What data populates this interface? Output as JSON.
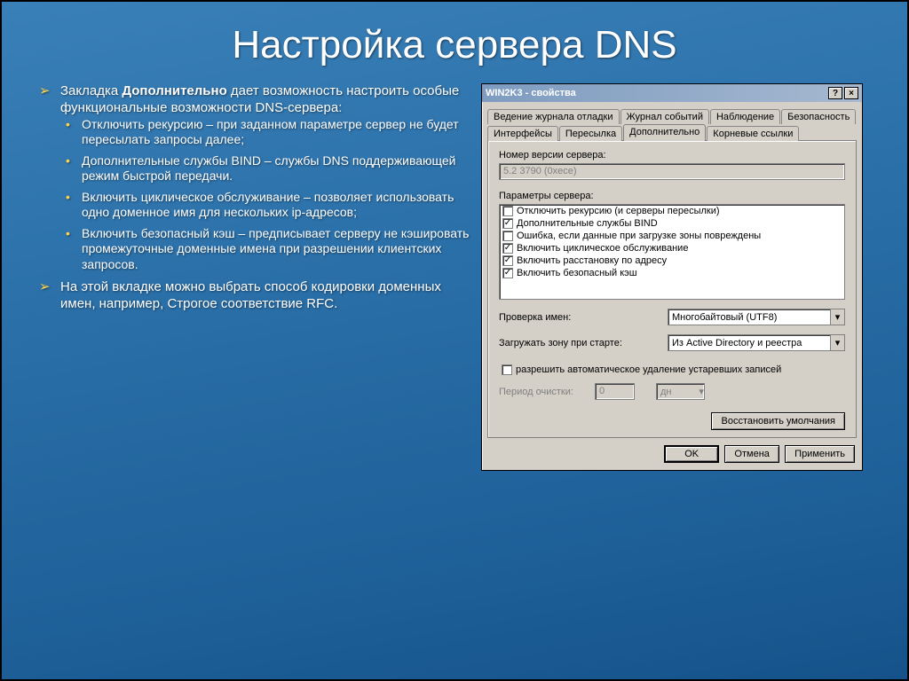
{
  "slide": {
    "title": "Настройка сервера DNS",
    "bullets": {
      "b1_prefix": "Закладка ",
      "b1_bold": "Дополнительно",
      "b1_suffix": " дает возможность настроить особые функциональные возможности DNS-сервера:",
      "sub1": "Отключить рекурсию – при заданном параметре сервер не будет пересылать запросы далее;",
      "sub2": "Дополнительные службы BIND – службы DNS поддерживающей режим быстрой передачи.",
      "sub3": "Включить циклическое обслуживание – позволяет использовать одно доменное имя для нескольких ip-адресов;",
      "sub4": "Включить безопасный кэш – предписывает серверу не кэшировать промежуточные доменные имена при разрешении клиентских запросов.",
      "b2": "На этой вкладке можно выбрать способ кодировки доменных имен, например, Строгое соответствие RFC."
    }
  },
  "dialog": {
    "title": "WIN2K3 - свойства",
    "help_icon": "?",
    "close_icon": "×",
    "tabs_row1": [
      "Ведение журнала отладки",
      "Журнал событий",
      "Наблюдение",
      "Безопасность"
    ],
    "tabs_row2": [
      "Интерфейсы",
      "Пересылка",
      "Дополнительно",
      "Корневые ссылки"
    ],
    "active_tab": "Дополнительно",
    "version_label": "Номер версии сервера:",
    "version_value": "5.2 3790 (0xece)",
    "params_label": "Параметры сервера:",
    "params": [
      {
        "checked": false,
        "text": "Отключить рекурсию (и серверы пересылки)"
      },
      {
        "checked": true,
        "text": "Дополнительные службы BIND"
      },
      {
        "checked": false,
        "text": "Ошибка, если данные при загрузке зоны повреждены"
      },
      {
        "checked": true,
        "text": "Включить циклическое обслуживание"
      },
      {
        "checked": true,
        "text": "Включить расстановку по адресу"
      },
      {
        "checked": true,
        "text": "Включить безопасный кэш"
      }
    ],
    "name_check_label": "Проверка имен:",
    "name_check_value": "Многобайтовый (UTF8)",
    "load_zone_label": "Загружать зону при старте:",
    "load_zone_value": "Из Active Directory и реестра",
    "auto_delete": {
      "checked": false,
      "text": "разрешить автоматическое удаление устаревших записей"
    },
    "period_label": "Период очистки:",
    "period_value": "0",
    "period_unit": "дн",
    "restore_btn": "Восстановить умолчания",
    "ok": "OK",
    "cancel": "Отмена",
    "apply": "Применить"
  }
}
